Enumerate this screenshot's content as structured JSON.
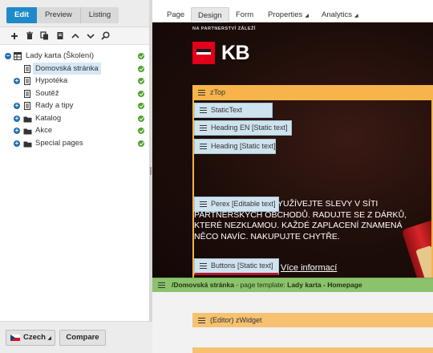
{
  "modes": [
    "Edit",
    "Preview",
    "Listing"
  ],
  "tree": {
    "root": "Lady karta (Školení)",
    "items": [
      {
        "label": "Domovská stránka",
        "expandable": false,
        "icon": "page-icon",
        "selected": true
      },
      {
        "label": "Hypotéka",
        "expandable": true,
        "icon": "page-icon"
      },
      {
        "label": "Soutěž",
        "expandable": false,
        "icon": "page-icon"
      },
      {
        "label": "Rady a tipy",
        "expandable": true,
        "icon": "page-icon"
      },
      {
        "label": "Katalog",
        "expandable": true,
        "icon": "folder-icon"
      },
      {
        "label": "Akce",
        "expandable": true,
        "icon": "folder-icon"
      },
      {
        "label": "Special pages",
        "expandable": true,
        "icon": "folder-icon"
      }
    ]
  },
  "bottom": {
    "language": "Czech",
    "compare": "Compare"
  },
  "tabs": [
    {
      "label": "Page",
      "dropdown": false
    },
    {
      "label": "Design",
      "dropdown": false,
      "active": true
    },
    {
      "label": "Form",
      "dropdown": false
    },
    {
      "label": "Properties",
      "dropdown": true
    },
    {
      "label": "Analytics",
      "dropdown": true
    }
  ],
  "canvas": {
    "promo_line": "NA PARTNERSTVÍ ZÁLEŽÍ",
    "logo_text": "KB",
    "zone_title": "zTop",
    "components": {
      "static": "StaticText",
      "heading_en": "Heading EN [Static text]",
      "heading": "Heading [Static text]",
      "perex": "Perex [Editable text]",
      "buttons": "Buttons [Static text]"
    },
    "perex_text": "RÁ VÁM TO VRÁTÍ. VYUŽÍVEJTE SLEVY V SÍTI PARTNERSKÝCH OBCHODŮ. RADUJTE SE Z DÁRKŮ, KTERÉ NEZKLAMOU. KAŽDÉ ZAPLACENÍ ZNAMENÁ NĚCO NAVÍC. NAKUPUJTE CHYTŘE.",
    "more_link": "Více informací",
    "page_path": "/Domovská stránka",
    "template_label": "page template:",
    "template_name": "Lady karta - Homepage",
    "widget_zone": "(Editor) zWidget"
  },
  "colors": {
    "accent": "#1f8ac9",
    "zone": "#f6b44a",
    "page_bar": "#8cc26b",
    "component": "#cfe3ee",
    "brand": "#e2001a"
  }
}
